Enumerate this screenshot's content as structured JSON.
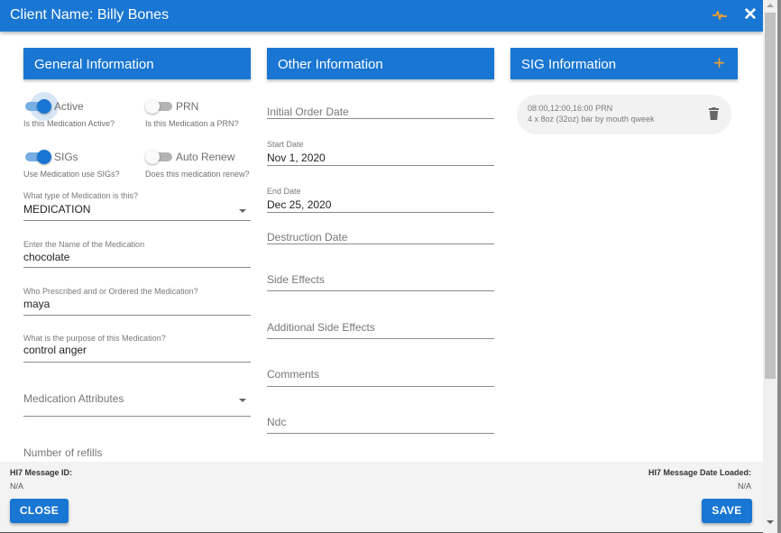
{
  "header": {
    "title": "Client Name: Billy Bones",
    "icons": [
      "pulse-icon",
      "close-icon"
    ],
    "accent_color": "#1976d2",
    "icon_accent_color": "#f0a030"
  },
  "general": {
    "heading": "General Information",
    "toggles": [
      {
        "label": "Active",
        "help": "Is this Medication Active?",
        "on": true
      },
      {
        "label": "PRN",
        "help": "Is this Medication a PRN?",
        "on": false
      },
      {
        "label": "SIGs",
        "help": "Use Medication use SIGs?",
        "on": true
      },
      {
        "label": "Auto Renew",
        "help": "Does this medication renew?",
        "on": false
      }
    ],
    "medication_type": {
      "label": "What type of Medication is this?",
      "value": "MEDICATION"
    },
    "medication_name": {
      "label": "Enter the Name of the Medication",
      "value": "chocolate"
    },
    "prescriber": {
      "label": "Who Prescribed and or Ordered the Medication?",
      "value": "maya"
    },
    "purpose": {
      "label": "What is the purpose of this Medication?",
      "value": "control anger"
    },
    "attributes": {
      "placeholder": "Medication Attributes"
    },
    "refills": {
      "placeholder": "Number of refills"
    }
  },
  "other": {
    "heading": "Other Information",
    "initial_order_date": {
      "placeholder": "Initial Order Date"
    },
    "start_date": {
      "label": "Start Date",
      "value": "Nov 1, 2020"
    },
    "end_date": {
      "label": "End Date",
      "value": "Dec 25, 2020"
    },
    "destruction_date": {
      "placeholder": "Destruction Date"
    },
    "side_effects": {
      "placeholder": "Side Effects"
    },
    "additional_side_effects": {
      "placeholder": "Additional Side Effects"
    },
    "comments": {
      "placeholder": "Comments"
    },
    "ndc": {
      "placeholder": "Ndc"
    }
  },
  "sig": {
    "heading": "SIG Information",
    "add_icon": "plus-icon",
    "items": [
      {
        "line1": "08:00,12:00,16:00 PRN",
        "line2": "4 x 8oz (32oz) bar by mouth qweek"
      }
    ]
  },
  "footer": {
    "message_id_label": "HI7 Message ID:",
    "message_id_value": "N/A",
    "date_loaded_label": "HI7 Message Date Loaded:",
    "date_loaded_value": "N/A",
    "close_label": "CLOSE",
    "save_label": "SAVE"
  }
}
